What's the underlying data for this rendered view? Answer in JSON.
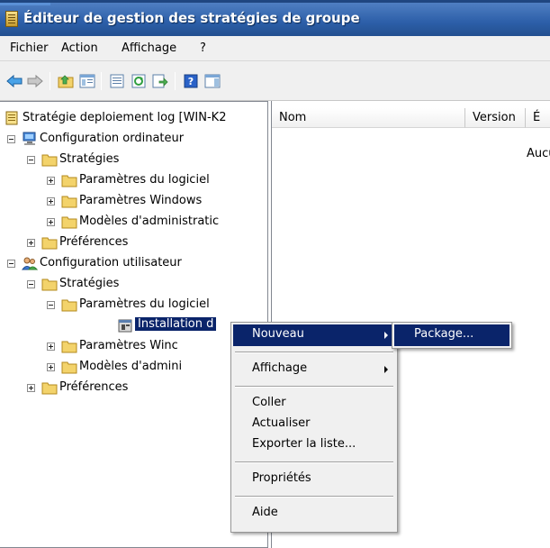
{
  "window": {
    "title": "Éditeur de gestion des stratégies de groupe",
    "title_bar_color": "#2c5ea8"
  },
  "menubar": {
    "items": [
      "Fichier",
      "Action",
      "Affichage",
      "?"
    ]
  },
  "toolbar": {
    "icons": [
      "back-icon",
      "forward-icon",
      "up-folder-icon",
      "show-hide-tree-icon",
      "properties-icon",
      "refresh-icon",
      "export-list-icon",
      "help-icon",
      "show-hide-action-pane-icon"
    ]
  },
  "tree": {
    "root": "Stratégie deploiement log [WIN-K2",
    "computer_config": "Configuration ordinateur",
    "computer_policies": "Stratégies",
    "computer_software": "Paramètres du logiciel",
    "computer_windows": "Paramètres Windows",
    "computer_admin": "Modèles d'administratic",
    "computer_prefs": "Préférences",
    "user_config": "Configuration utilisateur",
    "user_policies": "Stratégies",
    "user_software": "Paramètres du logiciel",
    "software_install": "Installation d",
    "user_windows": "Paramètres Winc",
    "user_admin": "Modèles d'admini",
    "user_prefs": "Préférences"
  },
  "list": {
    "columns": [
      "Nom",
      "Version",
      "É"
    ],
    "empty_text": "Aucu"
  },
  "context_menu": {
    "new": "Nouveau",
    "view": "Affichage",
    "paste": "Coller",
    "refresh": "Actualiser",
    "export": "Exporter la liste...",
    "properties": "Propriétés",
    "help": "Aide"
  },
  "submenu": {
    "package": "Package..."
  },
  "colors": {
    "highlight": "#0a246a",
    "menu_bg": "#f0f0f0",
    "folder": "#f3d36b"
  }
}
